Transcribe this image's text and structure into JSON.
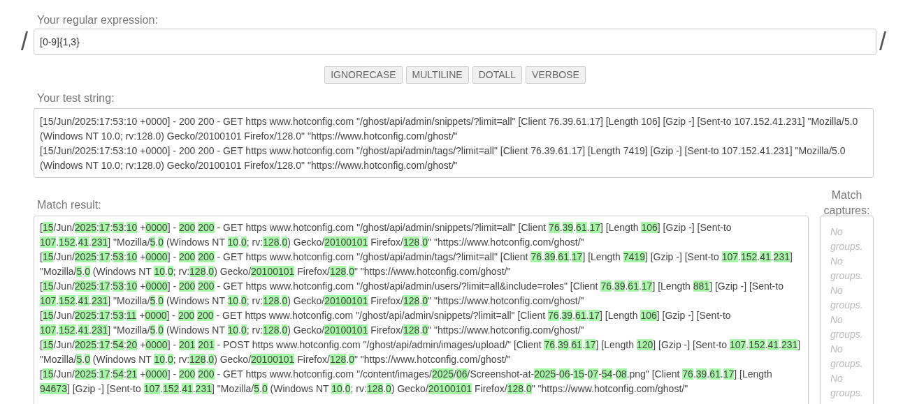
{
  "regex": {
    "label": "Your regular expression:",
    "delimiter_left": "/",
    "value": "[0-9]{1,3}",
    "delimiter_right": "/"
  },
  "options": [
    {
      "label": "IGNORECASE",
      "selected": false
    },
    {
      "label": "MULTILINE",
      "selected": false
    },
    {
      "label": "DOTALL",
      "selected": false
    },
    {
      "label": "VERBOSE",
      "selected": false
    }
  ],
  "test_string": {
    "label": "Your test string:",
    "lines": [
      "[15/Jun/2025:17:53:10 +0000] - 200 200 - GET https www.hotconfig.com \"/ghost/api/admin/snippets/?limit=all\" [Client 76.39.61.17] [Length 106] [Gzip -] [Sent-to 107.152.41.231] \"Mozilla/5.0 (Windows NT 10.0; rv:128.0) Gecko/20100101 Firefox/128.0\" \"https://www.hotconfig.com/ghost/\"",
      "[15/Jun/2025:17:53:10 +0000] - 200 200 - GET https www.hotconfig.com \"/ghost/api/admin/tags/?limit=all\" [Client 76.39.61.17] [Length 7419] [Gzip -] [Sent-to 107.152.41.231] \"Mozilla/5.0 (Windows NT 10.0; rv:128.0) Gecko/20100101 Firefox/128.0\" \"https://www.hotconfig.com/ghost/\""
    ]
  },
  "match_result": {
    "label": "Match result:",
    "lines": [
      "[15/Jun/2025:17:53:10 +0000] - 200 200 - GET https www.hotconfig.com \"/ghost/api/admin/snippets/?limit=all\" [Client 76.39.61.17] [Length 106] [Gzip -] [Sent-to 107.152.41.231] \"Mozilla/5.0 (Windows NT 10.0; rv:128.0) Gecko/20100101 Firefox/128.0\" \"https://www.hotconfig.com/ghost/\"",
      "[15/Jun/2025:17:53:10 +0000] - 200 200 - GET https www.hotconfig.com \"/ghost/api/admin/tags/?limit=all\" [Client 76.39.61.17] [Length 7419] [Gzip -] [Sent-to 107.152.41.231] \"Mozilla/5.0 (Windows NT 10.0; rv:128.0) Gecko/20100101 Firefox/128.0\" \"https://www.hotconfig.com/ghost/\"",
      "[15/Jun/2025:17:53:10 +0000] - 200 200 - GET https www.hotconfig.com \"/ghost/api/admin/users/?limit=all&include=roles\" [Client 76.39.61.17] [Length 881] [Gzip -] [Sent-to 107.152.41.231] \"Mozilla/5.0 (Windows NT 10.0; rv:128.0) Gecko/20100101 Firefox/128.0\" \"https://www.hotconfig.com/ghost/\"",
      "[15/Jun/2025:17:53:11 +0000] - 200 200 - GET https www.hotconfig.com \"/ghost/api/admin/snippets/?limit=all\" [Client 76.39.61.17] [Length 106] [Gzip -] [Sent-to 107.152.41.231] \"Mozilla/5.0 (Windows NT 10.0; rv:128.0) Gecko/20100101 Firefox/128.0\" \"https://www.hotconfig.com/ghost/\"",
      "[15/Jun/2025:17:54:20 +0000] - 201 201 - POST https www.hotconfig.com \"/ghost/api/admin/images/upload/\" [Client 76.39.61.17] [Length 120] [Gzip -] [Sent-to 107.152.41.231] \"Mozilla/5.0 (Windows NT 10.0; rv:128.0) Gecko/20100101 Firefox/128.0\" \"https://www.hotconfig.com/ghost/\"",
      "[15/Jun/2025:17:54:21 +0000] - 200 200 - GET https www.hotconfig.com \"/content/images/2025/06/Screenshot-at-2025-06-15-07-54-08.png\" [Client 76.39.61.17] [Length 94673] [Gzip -] [Sent-to 107.152.41.231] \"Mozilla/5.0 (Windows NT 10.0; rv:128.0) Gecko/20100101 Firefox/128.0\" \"https://www.hotconfig.com/ghost/\""
    ]
  },
  "match_captures": {
    "label": "Match captures:",
    "items": [
      "No groups.",
      "No groups.",
      "No groups.",
      "No groups.",
      "No groups.",
      "No groups."
    ]
  }
}
